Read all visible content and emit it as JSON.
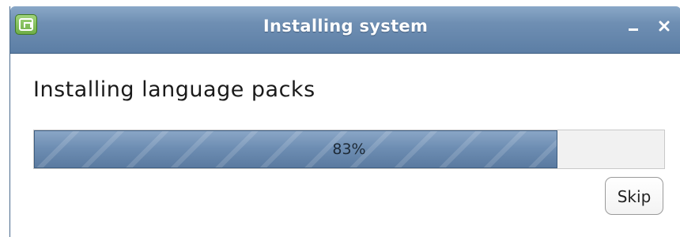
{
  "window": {
    "title": "Installing system",
    "icon": "linux-mint-icon",
    "controls": {
      "minimize_icon": "minimize-icon",
      "close_icon": "close-icon"
    }
  },
  "content": {
    "heading": "Installing language packs",
    "progress": {
      "percent": 83,
      "label": "83%"
    },
    "skip_label": "Skip"
  },
  "colors": {
    "titlebar": "#6f8fb3",
    "progress_fill": "#6e8eb3",
    "app_icon": "#7fbf55"
  }
}
